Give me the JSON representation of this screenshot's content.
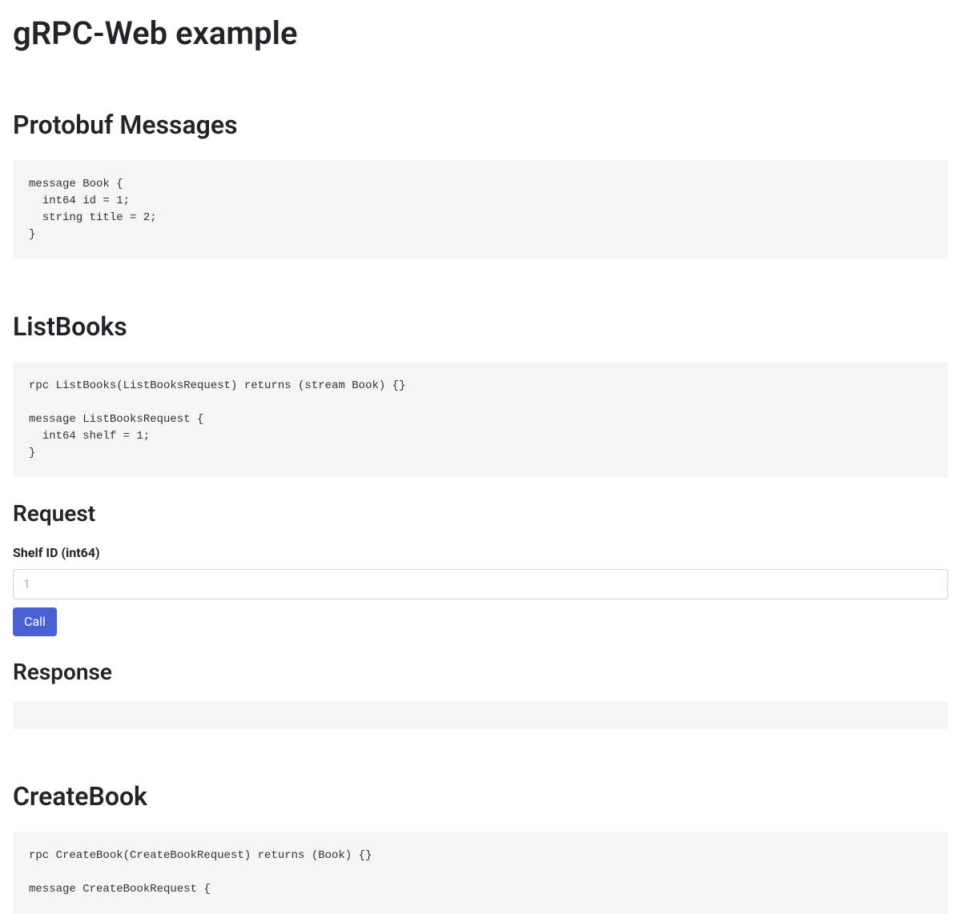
{
  "page": {
    "title": "gRPC-Web example"
  },
  "protobuf": {
    "heading": "Protobuf Messages",
    "code": "message Book {\n  int64 id = 1;\n  string title = 2;\n}"
  },
  "listBooks": {
    "heading": "ListBooks",
    "code": "rpc ListBooks(ListBooksRequest) returns (stream Book) {}\n\nmessage ListBooksRequest {\n  int64 shelf = 1;\n}",
    "request": {
      "heading": "Request",
      "shelfLabel": "Shelf ID (int64)",
      "shelfPlaceholder": "1",
      "shelfValue": "",
      "callLabel": "Call"
    },
    "response": {
      "heading": "Response",
      "body": ""
    }
  },
  "createBook": {
    "heading": "CreateBook",
    "code": "rpc CreateBook(CreateBookRequest) returns (Book) {}\n\nmessage CreateBookRequest {"
  }
}
